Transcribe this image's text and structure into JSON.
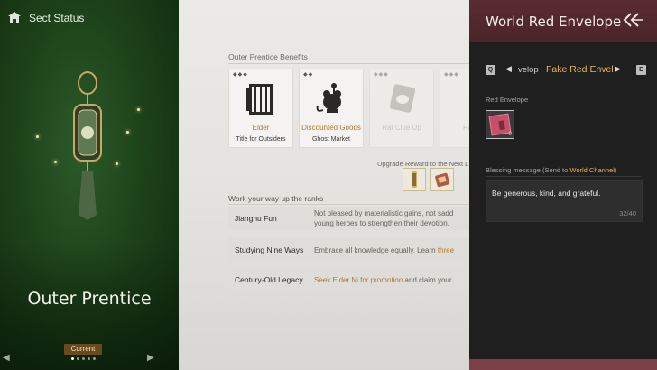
{
  "left": {
    "header_title": "Sect Status",
    "rank_title": "Outer Prentice",
    "current_badge": "Current",
    "page_dots": 5,
    "active_dot": 0
  },
  "center": {
    "benefits_label": "Outer Prentice Benefits",
    "cards": [
      {
        "pips": "◆◆◆",
        "name": "Elder",
        "sub": "Title for Outsiders",
        "icon": "book-scroll-icon"
      },
      {
        "pips": "◆◆",
        "name": "Discounted Goods",
        "sub": "Ghost Market",
        "icon": "rat-merchant-icon"
      },
      {
        "pips": "◆◆◆",
        "name": "Rat Clue Up",
        "sub": "",
        "icon": "rat-clue-icon"
      },
      {
        "pips": "◆◆◆",
        "name": "Rat V",
        "sub": "",
        "icon": "rat-icon"
      }
    ],
    "upgrade_label": "Upgrade Reward to the Next L",
    "ranks_label": "Work your way up the ranks",
    "ranks": [
      {
        "name": "Jianghu Fun",
        "desc_line1": "Not pleased by materialistic gains, not sadd",
        "desc_line2": "young heroes to strengthen their devotion."
      },
      {
        "name": "Studying Nine Ways",
        "desc_plain": "Embrace all knowledge equally. Learn ",
        "desc_hl": "three"
      },
      {
        "name": "Century-Old Legacy",
        "desc_hl": "Seek Elder Ni for promotion",
        "desc_plain": " and claim your"
      }
    ]
  },
  "right": {
    "title": "World Red Envelope",
    "key_left": "Q",
    "key_right": "E",
    "tab_prev": "velop",
    "tab_active": "Fake Red Envel",
    "envelope_label": "Red Envelope",
    "envelope_count": "0",
    "blessing_label": "Blessing message  (Send to ",
    "blessing_channel": "World Channel",
    "blessing_label_end": ")",
    "blessing_text": "Be generous, kind, and grateful.",
    "char_count": "32/40"
  },
  "colors": {
    "accent_gold": "#e7b65b",
    "benefit_gold": "#b0782f",
    "header_maroon": "#5a2c31",
    "left_green": "#1d4219"
  }
}
